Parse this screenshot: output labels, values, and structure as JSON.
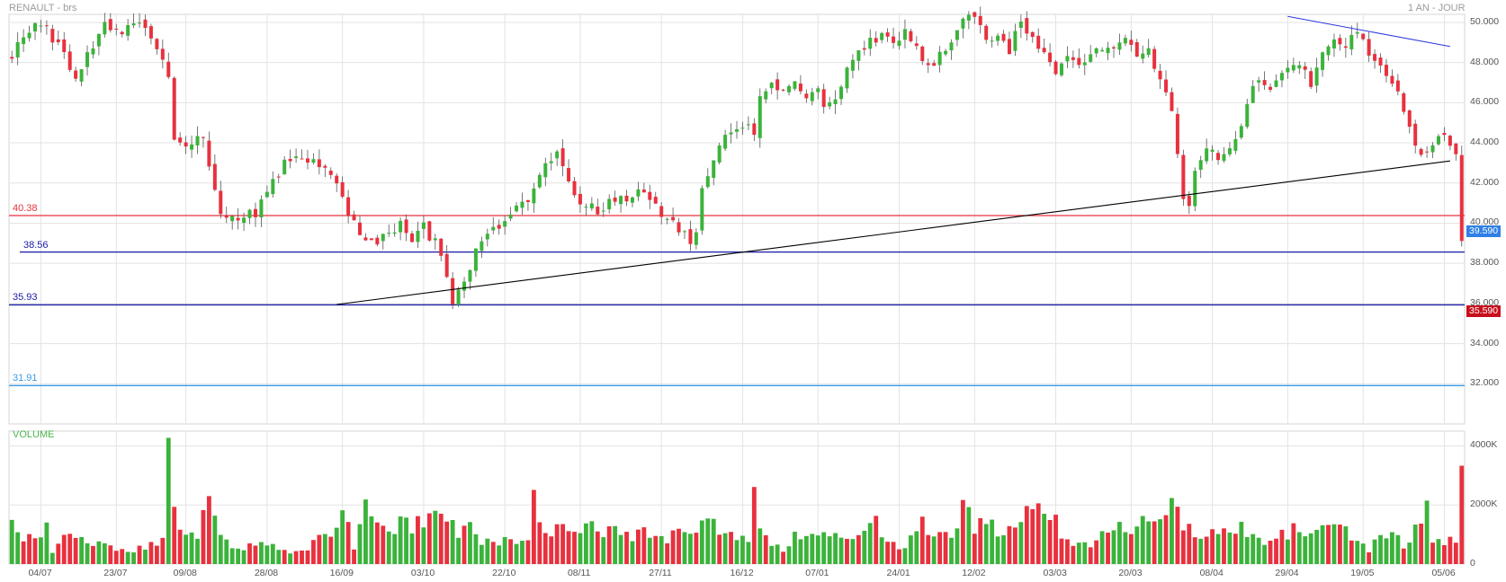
{
  "header": {
    "title": "RENAULT - brs",
    "period": "1 AN - JOUR"
  },
  "colors": {
    "up": "#3bb33b",
    "down": "#e8313e",
    "grid": "#e3e3e3",
    "red_level": "#e8313e",
    "blue_level": "#1a1aa8",
    "light_blue_level": "#3a9ae8",
    "trend_black": "#000000",
    "trend_blue": "#2a3ae0",
    "current_price_bg": "#2f7fe6",
    "low_price_bg": "#c8101c",
    "volume_title": "#4cb64c"
  },
  "chart_data": [
    {
      "type": "candlestick",
      "title": "RENAULT - brs",
      "period": "1 AN - JOUR",
      "ylim": [
        30.0,
        50.4
      ],
      "yticks": [
        "50.000",
        "48.000",
        "46.000",
        "44.000",
        "42.000",
        "40.000",
        "38.000",
        "36.000",
        "34.000",
        "32.000"
      ],
      "ytick_values": [
        50,
        48,
        46,
        44,
        42,
        40,
        38,
        36,
        34,
        32
      ],
      "xticks": [
        "04/07",
        "23/07",
        "09/08",
        "28/08",
        "16/09",
        "03/10",
        "22/10",
        "08/11",
        "27/11",
        "16/12",
        "07/01",
        "24/01",
        "12/02",
        "03/03",
        "20/03",
        "08/04",
        "29/04",
        "19/05",
        "05/06"
      ],
      "levels": [
        {
          "label": "40.38",
          "value": 40.38,
          "color": "#e8313e"
        },
        {
          "label": "38.56",
          "value": 38.56,
          "color": "#1a1aa8"
        },
        {
          "label": "35.93",
          "value": 35.93,
          "color": "#1a1aa8"
        },
        {
          "label": "31.91",
          "value": 31.91,
          "color": "#3a9ae8"
        }
      ],
      "price_tags": [
        {
          "label": "39.590",
          "value": 39.59,
          "color": "#2f7fe6"
        },
        {
          "label": "35.590",
          "value": 35.59,
          "color": "#c8101c"
        }
      ],
      "trendlines": [
        {
          "from": [
            56,
            35.95
          ],
          "to": [
            248,
            43.1
          ],
          "color": "#000000"
        },
        {
          "from": [
            220,
            50.3
          ],
          "to": [
            248,
            48.8
          ],
          "color": "#2a3ae0"
        }
      ],
      "anchors": [
        [
          0,
          48.4
        ],
        [
          2,
          49.2
        ],
        [
          5,
          50.0
        ],
        [
          8,
          48.8
        ],
        [
          11,
          47.3
        ],
        [
          14,
          48.9
        ],
        [
          16,
          50.0
        ],
        [
          19,
          49.6
        ],
        [
          22,
          50.1
        ],
        [
          25,
          48.6
        ],
        [
          27,
          47.3
        ],
        [
          28,
          44.0
        ],
        [
          30,
          43.8
        ],
        [
          33,
          44.2
        ],
        [
          34,
          42.9
        ],
        [
          36,
          40.6
        ],
        [
          39,
          40.3
        ],
        [
          42,
          40.5
        ],
        [
          45,
          42.1
        ],
        [
          47,
          43.0
        ],
        [
          50,
          43.2
        ],
        [
          53,
          42.9
        ],
        [
          55,
          42.3
        ],
        [
          57,
          41.3
        ],
        [
          59,
          40.0
        ],
        [
          61,
          39.1
        ],
        [
          63,
          38.9
        ],
        [
          65,
          39.5
        ],
        [
          67,
          39.9
        ],
        [
          69,
          38.9
        ],
        [
          71,
          39.8
        ],
        [
          73,
          39.0
        ],
        [
          75,
          37.3
        ],
        [
          76,
          36.0
        ],
        [
          77,
          36.8
        ],
        [
          79,
          37.9
        ],
        [
          81,
          39.3
        ],
        [
          84,
          39.7
        ],
        [
          86,
          40.4
        ],
        [
          88,
          40.9
        ],
        [
          90,
          41.5
        ],
        [
          92,
          42.9
        ],
        [
          94,
          43.6
        ],
        [
          96,
          42.1
        ],
        [
          98,
          41.0
        ],
        [
          100,
          40.8
        ],
        [
          102,
          40.6
        ],
        [
          104,
          41.3
        ],
        [
          106,
          41.2
        ],
        [
          108,
          41.7
        ],
        [
          110,
          41.4
        ],
        [
          112,
          40.5
        ],
        [
          114,
          40.1
        ],
        [
          116,
          39.5
        ],
        [
          117,
          39.1
        ],
        [
          118,
          39.4
        ],
        [
          119,
          41.6
        ],
        [
          121,
          43.4
        ],
        [
          123,
          44.6
        ],
        [
          125,
          44.5
        ],
        [
          127,
          44.8
        ],
        [
          128,
          44.6
        ],
        [
          129,
          46.3
        ],
        [
          131,
          46.8
        ],
        [
          133,
          46.6
        ],
        [
          135,
          46.9
        ],
        [
          137,
          46.4
        ],
        [
          139,
          46.6
        ],
        [
          140,
          46.0
        ],
        [
          142,
          46.3
        ],
        [
          144,
          47.7
        ],
        [
          146,
          48.4
        ],
        [
          148,
          49.2
        ],
        [
          150,
          49.3
        ],
        [
          152,
          49.1
        ],
        [
          154,
          49.6
        ],
        [
          156,
          48.8
        ],
        [
          158,
          47.8
        ],
        [
          160,
          48.4
        ],
        [
          162,
          49.2
        ],
        [
          164,
          50.3
        ],
        [
          166,
          50.4
        ],
        [
          168,
          48.9
        ],
        [
          170,
          49.3
        ],
        [
          172,
          48.4
        ],
        [
          174,
          50.2
        ],
        [
          176,
          49.1
        ],
        [
          178,
          48.3
        ],
        [
          180,
          47.5
        ],
        [
          182,
          48.4
        ],
        [
          184,
          47.8
        ],
        [
          186,
          48.3
        ],
        [
          188,
          48.6
        ],
        [
          190,
          48.9
        ],
        [
          192,
          49.2
        ],
        [
          194,
          48.2
        ],
        [
          196,
          48.6
        ],
        [
          198,
          47.3
        ],
        [
          200,
          45.8
        ],
        [
          201,
          43.6
        ],
        [
          202,
          41.1
        ],
        [
          203,
          40.8
        ],
        [
          204,
          42.8
        ],
        [
          206,
          43.9
        ],
        [
          208,
          43.2
        ],
        [
          210,
          43.7
        ],
        [
          212,
          45.0
        ],
        [
          214,
          47.0
        ],
        [
          216,
          46.7
        ],
        [
          218,
          47.1
        ],
        [
          220,
          47.8
        ],
        [
          222,
          48.0
        ],
        [
          224,
          46.8
        ],
        [
          226,
          48.6
        ],
        [
          228,
          49.3
        ],
        [
          230,
          48.8
        ],
        [
          232,
          49.6
        ],
        [
          234,
          48.6
        ],
        [
          236,
          47.8
        ],
        [
          238,
          46.8
        ],
        [
          240,
          45.8
        ],
        [
          242,
          43.9
        ],
        [
          244,
          43.3
        ],
        [
          246,
          44.3
        ],
        [
          248,
          44.0
        ],
        [
          249,
          43.2
        ],
        [
          250,
          39.3
        ]
      ],
      "volume": {
        "title": "VOLUME",
        "ylim": [
          0,
          4500
        ],
        "yticks": [
          "4000K",
          "2000K",
          "0"
        ],
        "ytick_values": [
          4000,
          2000,
          0
        ],
        "anchors": [
          [
            0,
            1450
          ],
          [
            2,
            850
          ],
          [
            4,
            900
          ],
          [
            6,
            1200
          ],
          [
            7,
            400
          ],
          [
            10,
            1000
          ],
          [
            12,
            900
          ],
          [
            14,
            700
          ],
          [
            16,
            600
          ],
          [
            18,
            500
          ],
          [
            20,
            450
          ],
          [
            22,
            500
          ],
          [
            24,
            650
          ],
          [
            26,
            800
          ],
          [
            27,
            4200
          ],
          [
            28,
            1800
          ],
          [
            30,
            900
          ],
          [
            32,
            1100
          ],
          [
            34,
            2300
          ],
          [
            35,
            1600
          ],
          [
            36,
            900
          ],
          [
            38,
            700
          ],
          [
            40,
            550
          ],
          [
            42,
            650
          ],
          [
            44,
            700
          ],
          [
            46,
            500
          ],
          [
            48,
            350
          ],
          [
            50,
            450
          ],
          [
            52,
            700
          ],
          [
            54,
            900
          ],
          [
            56,
            1300
          ],
          [
            58,
            1800
          ],
          [
            59,
            600
          ],
          [
            61,
            1850
          ],
          [
            63,
            1300
          ],
          [
            65,
            900
          ],
          [
            67,
            1700
          ],
          [
            69,
            1200
          ],
          [
            71,
            1600
          ],
          [
            73,
            1850
          ],
          [
            75,
            1700
          ],
          [
            77,
            1100
          ],
          [
            79,
            1300
          ],
          [
            81,
            750
          ],
          [
            83,
            650
          ],
          [
            85,
            800
          ],
          [
            87,
            900
          ],
          [
            89,
            700
          ],
          [
            90,
            2100
          ],
          [
            91,
            1500
          ],
          [
            93,
            1100
          ],
          [
            95,
            1200
          ],
          [
            97,
            1300
          ],
          [
            99,
            1400
          ],
          [
            101,
            1200
          ],
          [
            103,
            1100
          ],
          [
            105,
            1000
          ],
          [
            107,
            900
          ],
          [
            109,
            1000
          ],
          [
            111,
            800
          ],
          [
            113,
            900
          ],
          [
            115,
            1300
          ],
          [
            117,
            1100
          ],
          [
            119,
            1450
          ],
          [
            121,
            1500
          ],
          [
            123,
            1000
          ],
          [
            125,
            900
          ],
          [
            127,
            850
          ],
          [
            128,
            2600
          ],
          [
            129,
            1400
          ],
          [
            131,
            800
          ],
          [
            133,
            500
          ],
          [
            135,
            900
          ],
          [
            137,
            1000
          ],
          [
            139,
            800
          ],
          [
            141,
            1000
          ],
          [
            143,
            1150
          ],
          [
            145,
            1000
          ],
          [
            147,
            1300
          ],
          [
            149,
            1500
          ],
          [
            151,
            700
          ],
          [
            153,
            600
          ],
          [
            155,
            800
          ],
          [
            157,
            1300
          ],
          [
            159,
            800
          ],
          [
            161,
            1100
          ],
          [
            163,
            1050
          ],
          [
            164,
            2100
          ],
          [
            166,
            1100
          ],
          [
            168,
            1400
          ],
          [
            170,
            1200
          ],
          [
            172,
            1300
          ],
          [
            174,
            1750
          ],
          [
            176,
            1850
          ],
          [
            178,
            1500
          ],
          [
            180,
            1400
          ],
          [
            182,
            800
          ],
          [
            184,
            600
          ],
          [
            186,
            600
          ],
          [
            188,
            900
          ],
          [
            190,
            1100
          ],
          [
            192,
            1200
          ],
          [
            194,
            1400
          ],
          [
            196,
            1500
          ],
          [
            198,
            1700
          ],
          [
            199,
            2200
          ],
          [
            200,
            2500
          ],
          [
            201,
            2200
          ],
          [
            202,
            1400
          ],
          [
            204,
            1200
          ],
          [
            206,
            900
          ],
          [
            208,
            1100
          ],
          [
            210,
            1300
          ],
          [
            212,
            1250
          ],
          [
            214,
            900
          ],
          [
            216,
            700
          ],
          [
            218,
            800
          ],
          [
            220,
            1100
          ],
          [
            222,
            1200
          ],
          [
            224,
            900
          ],
          [
            226,
            1150
          ],
          [
            228,
            1250
          ],
          [
            230,
            1050
          ],
          [
            232,
            700
          ],
          [
            234,
            500
          ],
          [
            236,
            900
          ],
          [
            238,
            1050
          ],
          [
            240,
            600
          ],
          [
            242,
            1200
          ],
          [
            244,
            1800
          ],
          [
            245,
            700
          ],
          [
            247,
            750
          ],
          [
            249,
            900
          ],
          [
            250,
            3500
          ]
        ]
      }
    }
  ],
  "candles_noise_seed": 73
}
